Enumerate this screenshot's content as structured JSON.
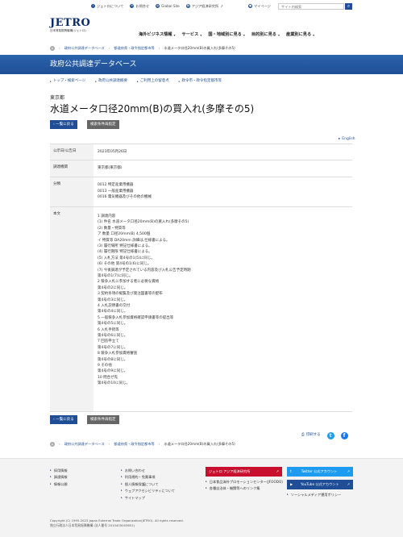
{
  "header": {
    "logo_text": "JETRO",
    "logo_sub": "日本貿易振興機構(ジェトロ)",
    "util_links": [
      "ジェトロについて",
      "お問合せ",
      "Global Site",
      "アジア経済研究所"
    ],
    "mypage_label": "マイページ",
    "search_placeholder": "サイト内検索",
    "gnav": [
      "海外ビジネス情報",
      "サービス",
      "国・地域別に見る",
      "目的別に見る",
      "産業別に見る"
    ]
  },
  "breadcrumb_top": [
    "政府公共調達データベース",
    "都道府県・政令指定都市等",
    "水道メータ口径20mm(B)の買入れ(多摩その5)"
  ],
  "banner_title": "政府公共調達データベース",
  "subnav": [
    "トップ・検索ページ",
    "政府公共調達概要",
    "ご利用上の留意点",
    "政令市・政令指定都市等"
  ],
  "prefecture": "東京都",
  "page_title": "水道メータ口径20mm(B)の買入れ(多摩その5)",
  "buttons": {
    "back": "一覧に戻る",
    "reset": "検索条件再指定"
  },
  "english_link": "English",
  "detail": {
    "rows": [
      {
        "label": "公示日/公告日",
        "lines": [
          "2023年05月26日"
        ]
      },
      {
        "label": "調達機関",
        "lines": [
          "東京都(東京都)"
        ]
      },
      {
        "label": "分類",
        "lines": [
          "0012 特定産業用機器",
          "0013 一般産業用機器",
          "0016 電気機器及びその他の機械"
        ]
      },
      {
        "label": "本文",
        "lines": [
          "",
          "1 調達内容",
          "(1) 件名 水道メータ口径20mm(B)の買入れ(多摩その5)",
          "(2) 数量・特質等",
          "ア 数量 口径20mm(B) 4,500個",
          "イ 特質等 DA20mm 詳細は,仕様書による。",
          "(3) 履行場所 特記仕様書による。",
          "(4) 履行期限 特記仕様書による。",
          "(5) 入札方法 第4号の1(5)に同じ。",
          "(6) その他 第4号の1(6)に同じ。",
          "(7) 今後調達が予定されている内容及び入札公告予定時期",
          "第4号の1(7)に同じ。",
          "2 競争入札に参加する者に必要な資格",
          "第4号の2に同じ。",
          "3 契約条項の縦覧及び発注図書等の配布",
          "第4号の3に同じ。",
          "4 入札説明書の交付",
          "第4号の4に同じ。",
          "5 一般競争入札参加資格確認申請書等の提出等",
          "第4号の5に同じ。",
          "6 入札手続等",
          "第4号の6に同じ。",
          "7 回答申立て",
          "第4号の7に同じ。",
          "8 競争入札参加資格審査",
          "第4号の8に同じ。",
          "9 その他",
          "第4号の9に同じ。",
          "10 問合せ先",
          "第4号の10に同じ。"
        ]
      }
    ]
  },
  "share": {
    "print": "印刷する"
  },
  "footer": {
    "col1": [
      "採用情報",
      "調達情報",
      "情報公開"
    ],
    "col2": [
      "お問い合わせ",
      "利用規約・免責事項",
      "個人情報保護について",
      "ウェブアクセシビリティについて",
      "サイトマップ"
    ],
    "col3_button": "ジェトロ アジア経済研究所",
    "col3_links": [
      "日本食品海外プロモーションセンター(JFOODO)",
      "各種自治体・機関等へのリンク集"
    ],
    "col4_twitter": "Twitter 公式アカウント",
    "col4_youtube": "YouTube 公式アカウント",
    "col4_social": "ソーシャルメディア運用ポリシー",
    "copyright": "Copyright (C) 1995-2023 Japan External Trade Organization(JETRO). All rights reserved.",
    "corp_no": "独立行政法人日本貿易振興機構 (法人番号 2010405003651)"
  },
  "colors": {
    "brand_blue": "#1f4e96",
    "red": "#c8102e",
    "twitter": "#1d9bf0"
  }
}
